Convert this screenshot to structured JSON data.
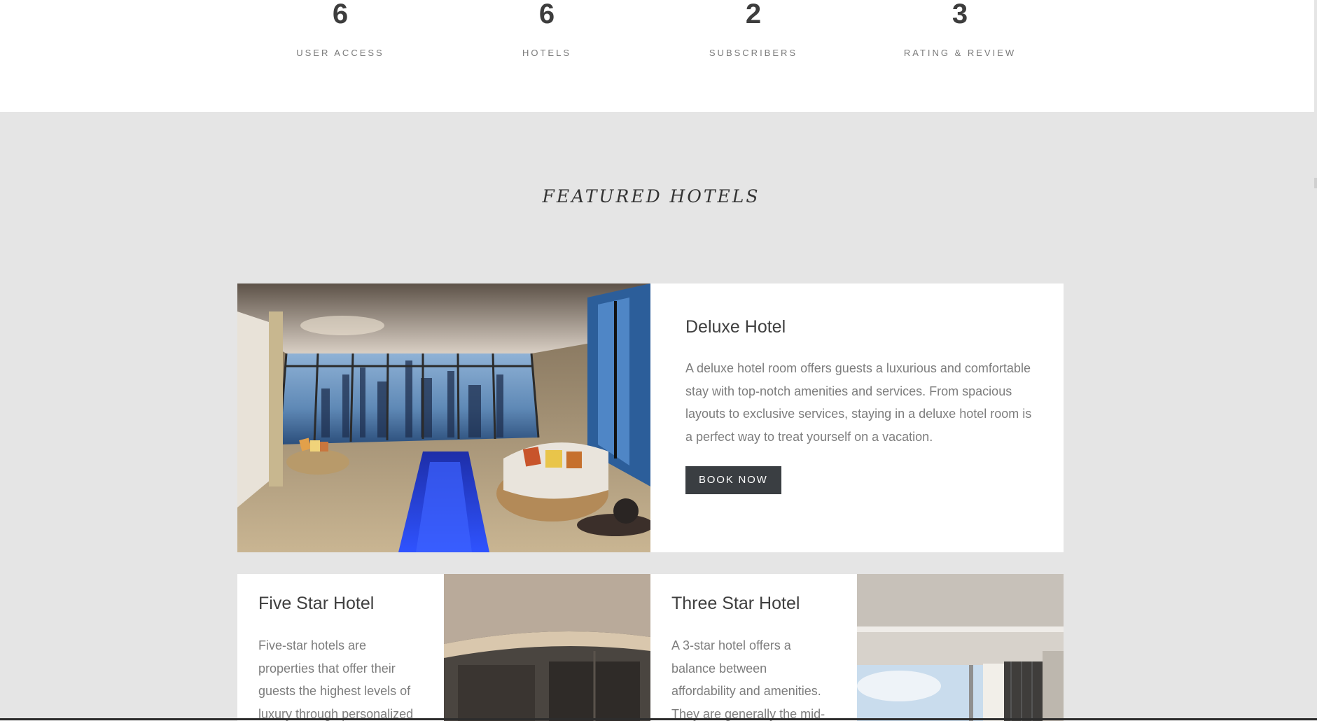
{
  "stats": [
    {
      "value": "6",
      "label": "USER ACCESS"
    },
    {
      "value": "6",
      "label": "HOTELS"
    },
    {
      "value": "2",
      "label": "SUBSCRIBERS"
    },
    {
      "value": "3",
      "label": "RATING & REVIEW"
    }
  ],
  "featured_section": {
    "title": "FEATURED HOTELS"
  },
  "hotels": [
    {
      "name": "Deluxe Hotel",
      "description": "A deluxe hotel room offers guests a luxurious and comfortable stay with top-notch amenities and services. From spacious layouts to exclusive services, staying in a deluxe hotel room is a perfect way to treat yourself on a vacation.",
      "button_label": "BOOK NOW",
      "image": "luxury-lounge-photo"
    },
    {
      "name": "Five Star Hotel",
      "description": "Five-star hotels are properties that offer their guests the highest levels of luxury through personalized",
      "image": "dark-interior-photo"
    },
    {
      "name": "Three Star Hotel",
      "description": "A 3-star hotel offers a balance between affordability and amenities. They are generally the mid-tier option",
      "image": "window-room-photo"
    }
  ],
  "colors": {
    "page_background": "#e5e5e5",
    "card_background": "#ffffff",
    "button_background": "#3a3e42",
    "button_text": "#ffffff",
    "heading_text": "#3f3f3f",
    "body_text": "#7d7d7d"
  }
}
